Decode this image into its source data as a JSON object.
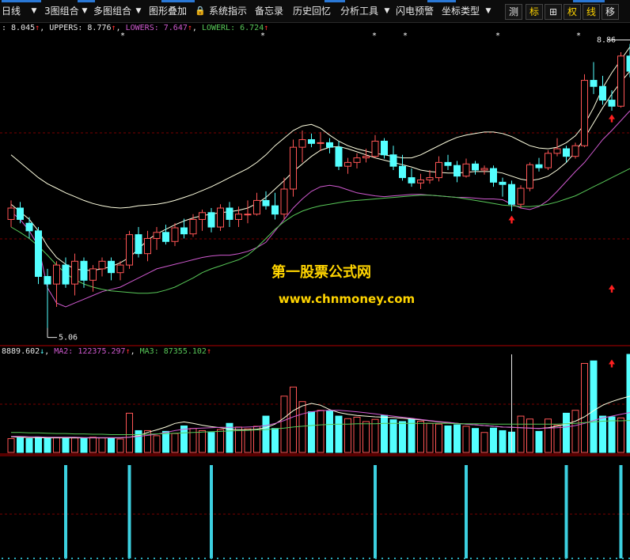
{
  "toolbar": {
    "items": [
      {
        "label": "日线",
        "dropdown": true
      },
      {
        "label": "3图组合",
        "dropdown": true
      },
      {
        "label": "多图组合",
        "dropdown": true
      },
      {
        "label": "图形叠加",
        "dropdown": false
      },
      {
        "label": "系统指示",
        "dropdown": false,
        "icon": "lock-icon"
      },
      {
        "label": "备忘录",
        "dropdown": false
      },
      {
        "label": "历史回忆",
        "dropdown": false
      },
      {
        "label": "分析工具",
        "dropdown": true
      },
      {
        "label": "闪电预警",
        "dropdown": false
      },
      {
        "label": "坐标类型",
        "dropdown": true
      }
    ],
    "right_buttons": [
      {
        "label": "测",
        "color": "#e8e8e8"
      },
      {
        "label": "标",
        "color": "#ffd400"
      },
      {
        "label": "田",
        "color": "#e8e8e8",
        "icon": "grid-icon"
      },
      {
        "label": "权",
        "color": "#ffd400"
      },
      {
        "label": "线",
        "color": "#ffd400"
      },
      {
        "label": "移",
        "color": "#e8e8e8"
      }
    ]
  },
  "price_panel": {
    "legend": [
      {
        "text": ": 8.045",
        "arrow": "↑",
        "color": "#e8e8e8"
      },
      {
        "text": "UPPERS: 8.776",
        "arrow": "↑",
        "color": "#e8e8e8"
      },
      {
        "text": "LOWERS: 7.647",
        "arrow": "↑",
        "color": "#d05ad0"
      },
      {
        "text": "LOWERL: 6.724",
        "arrow": "↑",
        "color": "#58c858"
      }
    ],
    "high_label": "8.86",
    "low_label": "5.06",
    "watermark_title": "第一股票公式网",
    "watermark_url": "www.chnmoney.com"
  },
  "volume_panel": {
    "legend": [
      {
        "text": "8889.602",
        "arrow": "↓",
        "color": "#e8e8e8"
      },
      {
        "text": "MA2: 122375.297",
        "arrow": "↑",
        "color": "#d05ad0"
      },
      {
        "text": "MA3: 87355.102",
        "arrow": "↑",
        "color": "#58c858"
      }
    ]
  },
  "colors": {
    "up": "#ff5555",
    "down": "#54ffff",
    "upper_band": "#ffffe0",
    "mid_line": "#ffffe0",
    "lowers": "#d05ad0",
    "lowerl": "#58c858",
    "watermark": "#ffd400",
    "signal": "#ff2020",
    "grid": "#7a0000",
    "separator": "#b00000"
  },
  "chart_data": {
    "type": "candlestick",
    "price_ylim": [
      4.9,
      9.0
    ],
    "candles": [
      [
        6.55,
        6.8,
        6.45,
        6.7
      ],
      [
        6.7,
        6.78,
        6.5,
        6.55
      ],
      [
        6.5,
        6.58,
        6.3,
        6.4
      ],
      [
        6.4,
        6.45,
        5.7,
        5.8
      ],
      [
        5.8,
        5.9,
        5.06,
        5.7
      ],
      [
        5.7,
        6.0,
        5.4,
        5.95
      ],
      [
        5.95,
        6.05,
        5.65,
        5.7
      ],
      [
        5.7,
        6.1,
        5.55,
        6.0
      ],
      [
        6.0,
        6.05,
        5.65,
        5.75
      ],
      [
        5.75,
        5.95,
        5.6,
        5.9
      ],
      [
        5.9,
        6.05,
        5.8,
        6.0
      ],
      [
        6.0,
        6.05,
        5.75,
        5.85
      ],
      [
        5.85,
        6.0,
        5.75,
        5.95
      ],
      [
        5.95,
        6.4,
        5.9,
        6.35
      ],
      [
        6.35,
        6.45,
        6.05,
        6.1
      ],
      [
        6.1,
        6.4,
        6.0,
        6.3
      ],
      [
        6.3,
        6.45,
        6.15,
        6.38
      ],
      [
        6.38,
        6.48,
        6.22,
        6.26
      ],
      [
        6.26,
        6.5,
        6.2,
        6.44
      ],
      [
        6.44,
        6.56,
        6.3,
        6.36
      ],
      [
        6.36,
        6.62,
        6.32,
        6.55
      ],
      [
        6.55,
        6.68,
        6.4,
        6.64
      ],
      [
        6.64,
        6.7,
        6.38,
        6.45
      ],
      [
        6.45,
        6.75,
        6.4,
        6.7
      ],
      [
        6.7,
        6.78,
        6.45,
        6.55
      ],
      [
        6.55,
        6.72,
        6.45,
        6.62
      ],
      [
        6.62,
        6.8,
        6.5,
        6.62
      ],
      [
        6.62,
        6.9,
        6.6,
        6.8
      ],
      [
        6.8,
        6.92,
        6.68,
        6.73
      ],
      [
        6.73,
        6.9,
        6.55,
        6.62
      ],
      [
        6.62,
        7.1,
        6.55,
        6.95
      ],
      [
        6.95,
        7.6,
        6.85,
        7.5
      ],
      [
        7.5,
        7.72,
        7.3,
        7.6
      ],
      [
        7.6,
        7.68,
        7.5,
        7.55
      ],
      [
        7.55,
        7.7,
        7.45,
        7.56
      ],
      [
        7.56,
        7.62,
        7.42,
        7.5
      ],
      [
        7.5,
        7.58,
        7.2,
        7.25
      ],
      [
        7.25,
        7.36,
        7.15,
        7.3
      ],
      [
        7.3,
        7.42,
        7.22,
        7.36
      ],
      [
        7.36,
        7.48,
        7.3,
        7.38
      ],
      [
        7.38,
        7.66,
        7.36,
        7.58
      ],
      [
        7.58,
        7.62,
        7.35,
        7.4
      ],
      [
        7.4,
        7.52,
        7.2,
        7.25
      ],
      [
        7.25,
        7.4,
        7.06,
        7.1
      ],
      [
        7.1,
        7.22,
        6.98,
        7.03
      ],
      [
        7.03,
        7.15,
        6.95,
        7.07
      ],
      [
        7.07,
        7.2,
        7.02,
        7.1
      ],
      [
        7.1,
        7.38,
        7.05,
        7.3
      ],
      [
        7.3,
        7.4,
        7.2,
        7.26
      ],
      [
        7.26,
        7.32,
        7.04,
        7.12
      ],
      [
        7.12,
        7.35,
        7.1,
        7.28
      ],
      [
        7.28,
        7.32,
        7.14,
        7.2
      ],
      [
        7.2,
        7.26,
        7.14,
        7.22
      ],
      [
        7.22,
        7.26,
        6.98,
        7.04
      ],
      [
        7.04,
        7.1,
        6.85,
        7.01
      ],
      [
        7.01,
        7.06,
        6.66,
        6.75
      ],
      [
        6.75,
        7.0,
        6.7,
        6.96
      ],
      [
        6.96,
        7.3,
        6.92,
        7.27
      ],
      [
        7.27,
        7.36,
        7.18,
        7.23
      ],
      [
        7.23,
        7.46,
        7.2,
        7.42
      ],
      [
        7.42,
        7.62,
        7.38,
        7.48
      ],
      [
        7.48,
        7.52,
        7.3,
        7.38
      ],
      [
        7.38,
        7.56,
        7.35,
        7.52
      ],
      [
        7.52,
        8.46,
        7.5,
        8.38
      ],
      [
        8.38,
        8.62,
        8.2,
        8.3
      ],
      [
        8.3,
        8.44,
        8.06,
        8.12
      ],
      [
        8.12,
        8.25,
        7.98,
        8.04
      ],
      [
        8.04,
        8.75,
        8.02,
        8.7
      ],
      [
        8.7,
        8.86,
        8.42,
        8.5
      ]
    ],
    "upper_band": [
      7.4,
      7.3,
      7.2,
      7.1,
      7.02,
      6.96,
      6.9,
      6.85,
      6.8,
      6.76,
      6.73,
      6.71,
      6.7,
      6.71,
      6.73,
      6.74,
      6.75,
      6.77,
      6.8,
      6.84,
      6.88,
      6.93,
      6.98,
      7.04,
      7.1,
      7.16,
      7.22,
      7.3,
      7.4,
      7.52,
      7.62,
      7.72,
      7.78,
      7.8,
      7.75,
      7.66,
      7.58,
      7.52,
      7.48,
      7.45,
      7.42,
      7.4,
      7.38,
      7.36,
      7.36,
      7.4,
      7.46,
      7.52,
      7.58,
      7.63,
      7.66,
      7.68,
      7.7,
      7.7,
      7.68,
      7.64,
      7.58,
      7.52,
      7.49,
      7.48,
      7.5,
      7.56,
      7.65,
      7.8,
      8.02,
      8.28,
      8.48,
      8.65,
      8.82
    ],
    "mid_line": [
      6.75,
      6.65,
      6.55,
      6.4,
      6.2,
      6.05,
      5.96,
      5.9,
      5.88,
      5.88,
      5.9,
      5.93,
      5.98,
      6.05,
      6.16,
      6.28,
      6.36,
      6.42,
      6.48,
      6.53,
      6.57,
      6.6,
      6.62,
      6.64,
      6.65,
      6.67,
      6.7,
      6.76,
      6.84,
      6.95,
      7.06,
      7.18,
      7.28,
      7.38,
      7.46,
      7.5,
      7.51,
      7.48,
      7.44,
      7.4,
      7.36,
      7.33,
      7.3,
      7.27,
      7.24,
      7.2,
      7.18,
      7.17,
      7.16,
      7.16,
      7.17,
      7.18,
      7.18,
      7.18,
      7.16,
      7.12,
      7.08,
      7.06,
      7.08,
      7.12,
      7.2,
      7.3,
      7.44,
      7.62,
      7.82,
      8.02,
      8.2,
      8.36,
      8.5
    ],
    "lowers": [
      6.65,
      6.55,
      6.4,
      6.2,
      5.65,
      5.45,
      5.4,
      5.45,
      5.5,
      5.55,
      5.6,
      5.63,
      5.66,
      5.72,
      5.78,
      5.84,
      5.9,
      5.93,
      5.96,
      5.99,
      6.02,
      6.05,
      6.07,
      6.08,
      6.08,
      6.1,
      6.13,
      6.18,
      6.25,
      6.4,
      6.55,
      6.7,
      6.82,
      6.92,
      6.98,
      7.0,
      6.98,
      6.94,
      6.9,
      6.88,
      6.86,
      6.85,
      6.86,
      6.87,
      6.88,
      6.88,
      6.87,
      6.86,
      6.85,
      6.84,
      6.84,
      6.83,
      6.82,
      6.82,
      6.81,
      6.75,
      6.7,
      6.68,
      6.72,
      6.8,
      6.92,
      7.05,
      7.18,
      7.3,
      7.45,
      7.6,
      7.72,
      7.85,
      7.98
    ],
    "lowerl": [
      6.45,
      6.38,
      6.3,
      6.2,
      6.08,
      5.95,
      5.84,
      5.76,
      5.7,
      5.66,
      5.63,
      5.61,
      5.6,
      5.59,
      5.58,
      5.58,
      5.59,
      5.62,
      5.66,
      5.72,
      5.78,
      5.85,
      5.9,
      5.94,
      5.98,
      6.02,
      6.08,
      6.18,
      6.3,
      6.42,
      6.52,
      6.6,
      6.66,
      6.7,
      6.73,
      6.75,
      6.77,
      6.79,
      6.8,
      6.81,
      6.82,
      6.83,
      6.84,
      6.85,
      6.86,
      6.87,
      6.87,
      6.86,
      6.85,
      6.84,
      6.82,
      6.8,
      6.78,
      6.76,
      6.74,
      6.73,
      6.72,
      6.72,
      6.73,
      6.75,
      6.78,
      6.82,
      6.86,
      6.92,
      6.98,
      7.04,
      7.1,
      7.16,
      7.22
    ],
    "signals_price": [
      {
        "index": 55,
        "value": 6.55
      },
      {
        "index": 66,
        "value": 7.88
      },
      {
        "index": 66,
        "value": 5.64
      }
    ],
    "signals_volume": [
      {
        "index": 66,
        "value": 245000
      }
    ],
    "volume_ylim": [
      0,
      270000
    ],
    "volume": [
      38000,
      40000,
      38000,
      42000,
      40000,
      41000,
      39000,
      40000,
      38000,
      42000,
      40000,
      39000,
      37000,
      108000,
      60000,
      60000,
      46000,
      58000,
      52000,
      73000,
      66000,
      60000,
      55000,
      63000,
      80000,
      70000,
      65000,
      72000,
      100000,
      66000,
      155000,
      180000,
      140000,
      112000,
      116000,
      115000,
      100000,
      93000,
      97000,
      85000,
      91000,
      102000,
      90000,
      85000,
      92000,
      86000,
      80000,
      78000,
      73000,
      76000,
      72000,
      66000,
      55000,
      67000,
      60000,
      56000,
      100000,
      92000,
      58000,
      92000,
      75000,
      108000,
      116000,
      245000,
      252000,
      100000,
      98000,
      95000,
      285000
    ],
    "vol_ma1": [
      43000,
      42000,
      41000,
      41000,
      40000,
      40000,
      40000,
      40000,
      40000,
      40000,
      40000,
      40000,
      40000,
      42000,
      46000,
      55000,
      62000,
      70000,
      80000,
      84000,
      80000,
      75000,
      71000,
      68000,
      64000,
      63000,
      62000,
      64000,
      68000,
      78000,
      95000,
      115000,
      128000,
      135000,
      130000,
      118000,
      110000,
      105000,
      102000,
      100000,
      98000,
      97000,
      96000,
      94000,
      92000,
      90000,
      87000,
      84000,
      82000,
      80000,
      78000,
      76000,
      74000,
      72000,
      70000,
      69000,
      68000,
      67000,
      66000,
      68000,
      72000,
      78000,
      86000,
      98000,
      115000,
      130000,
      140000,
      148000,
      155000
    ],
    "vol_ma2": [
      44000,
      44000,
      43000,
      43000,
      42000,
      42000,
      42000,
      42000,
      41000,
      41000,
      41000,
      41000,
      41000,
      42000,
      44000,
      47000,
      50000,
      55000,
      60000,
      64000,
      66000,
      67000,
      68000,
      69000,
      69000,
      69000,
      70000,
      71000,
      74000,
      80000,
      88000,
      98000,
      106000,
      112000,
      115000,
      116000,
      116000,
      114000,
      112000,
      109000,
      106000,
      103000,
      100000,
      97000,
      94000,
      91000,
      88000,
      85000,
      83000,
      80000,
      78000,
      76000,
      74000,
      72000,
      70000,
      69000,
      68000,
      67000,
      66000,
      67000,
      68000,
      70000,
      74000,
      80000,
      88000,
      95000,
      100000,
      105000,
      110000
    ],
    "vol_ma3": [
      55000,
      55000,
      54000,
      54000,
      53000,
      52000,
      52000,
      51000,
      51000,
      50000,
      50000,
      49000,
      49000,
      49000,
      49000,
      50000,
      51000,
      52000,
      53000,
      54000,
      55000,
      56000,
      57000,
      58000,
      59000,
      60000,
      61000,
      62000,
      63000,
      65000,
      67000,
      70000,
      72000,
      74000,
      76000,
      77000,
      78000,
      78000,
      79000,
      79000,
      79000,
      80000,
      80000,
      80000,
      80000,
      80000,
      80000,
      80000,
      80000,
      79000,
      79000,
      79000,
      79000,
      78000,
      78000,
      78000,
      78000,
      78000,
      78000,
      78000,
      78000,
      79000,
      80000,
      82000,
      84000,
      86000,
      87000,
      87000,
      88000
    ],
    "signal_bars": [
      6,
      13,
      22,
      40,
      50,
      61,
      67
    ]
  }
}
